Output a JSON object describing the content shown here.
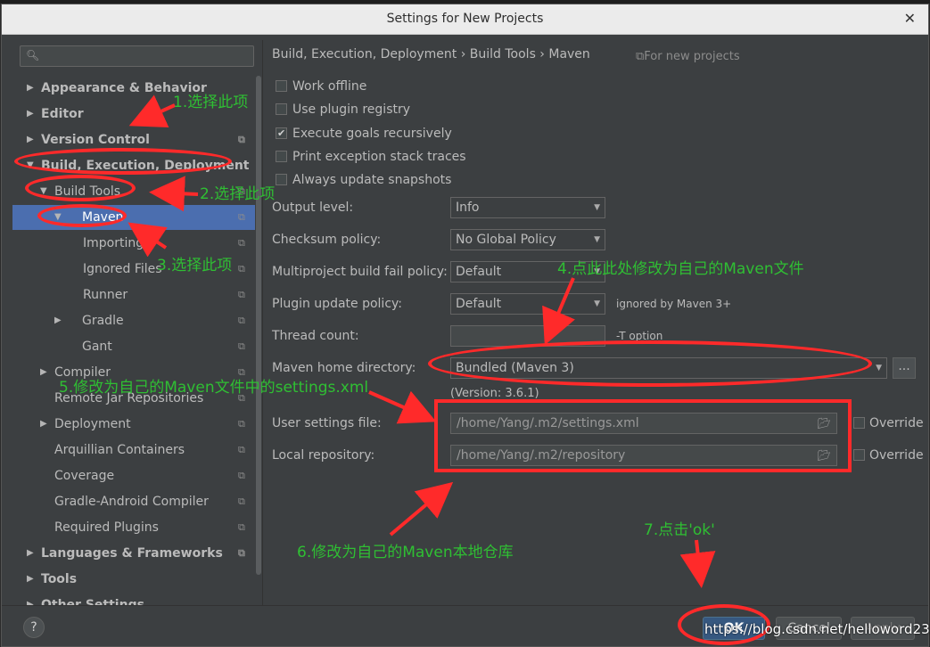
{
  "window": {
    "title": "Settings for New Projects"
  },
  "search": {
    "placeholder": ""
  },
  "tree": [
    {
      "label": "Appearance & Behavior",
      "bold": true,
      "depth": 0,
      "arrow": "right",
      "copy": false
    },
    {
      "label": "Editor",
      "bold": true,
      "depth": 0,
      "arrow": "right",
      "copy": false
    },
    {
      "label": "Version Control",
      "bold": true,
      "depth": 0,
      "arrow": "right",
      "copy": true
    },
    {
      "label": "Build, Execution, Deployment",
      "bold": true,
      "depth": 0,
      "arrow": "down",
      "copy": false
    },
    {
      "label": "Build Tools",
      "bold": false,
      "depth": 1,
      "arrow": "down",
      "copy": true
    },
    {
      "label": "Maven",
      "bold": false,
      "depth": 2,
      "arrow": "down",
      "copy": true,
      "selected": true
    },
    {
      "label": "Importing",
      "bold": false,
      "depth": 3,
      "arrow": "",
      "copy": true
    },
    {
      "label": "Ignored Files",
      "bold": false,
      "depth": 3,
      "arrow": "",
      "copy": true
    },
    {
      "label": "Runner",
      "bold": false,
      "depth": 3,
      "arrow": "",
      "copy": true
    },
    {
      "label": "Gradle",
      "bold": false,
      "depth": 2,
      "arrow": "right",
      "copy": true
    },
    {
      "label": "Gant",
      "bold": false,
      "depth": 2,
      "arrow": "",
      "copy": true
    },
    {
      "label": "Compiler",
      "bold": false,
      "depth": 1,
      "arrow": "right",
      "copy": true
    },
    {
      "label": "Remote Jar Repositories",
      "bold": false,
      "depth": 1,
      "arrow": "",
      "copy": true
    },
    {
      "label": "Deployment",
      "bold": false,
      "depth": 1,
      "arrow": "right",
      "copy": true
    },
    {
      "label": "Arquillian Containers",
      "bold": false,
      "depth": 1,
      "arrow": "",
      "copy": true
    },
    {
      "label": "Coverage",
      "bold": false,
      "depth": 1,
      "arrow": "",
      "copy": true
    },
    {
      "label": "Gradle-Android Compiler",
      "bold": false,
      "depth": 1,
      "arrow": "",
      "copy": true
    },
    {
      "label": "Required Plugins",
      "bold": false,
      "depth": 1,
      "arrow": "",
      "copy": true
    },
    {
      "label": "Languages & Frameworks",
      "bold": true,
      "depth": 0,
      "arrow": "right",
      "copy": true
    },
    {
      "label": "Tools",
      "bold": true,
      "depth": 0,
      "arrow": "right",
      "copy": false
    },
    {
      "label": "Other Settings",
      "bold": true,
      "depth": 0,
      "arrow": "right",
      "copy": false
    }
  ],
  "breadcrumb": {
    "text": "Build, Execution, Deployment  ›  Build Tools  ›  Maven"
  },
  "scope_note": "For new projects",
  "checkboxes": [
    {
      "label": "Work offline",
      "checked": false
    },
    {
      "label": "Use plugin registry",
      "checked": false
    },
    {
      "label": "Execute goals recursively",
      "checked": true
    },
    {
      "label": "Print exception stack traces",
      "checked": false
    },
    {
      "label": "Always update snapshots",
      "checked": false
    }
  ],
  "fields": {
    "output_level": {
      "label": "Output level:",
      "value": "Info"
    },
    "checksum_policy": {
      "label": "Checksum policy:",
      "value": "No Global Policy"
    },
    "fail_policy": {
      "label": "Multiproject build fail policy:",
      "value": "Default"
    },
    "plugin_update": {
      "label": "Plugin update policy:",
      "value": "Default",
      "hint": "ignored by Maven 3+"
    },
    "thread_count": {
      "label": "Thread count:",
      "value": "",
      "hint": "-T option"
    },
    "maven_home": {
      "label": "Maven home directory:",
      "value": "Bundled (Maven 3)",
      "version": "(Version: 3.6.1)",
      "browse": "..."
    },
    "user_settings": {
      "label": "User settings file:",
      "value": "/home/Yang/.m2/settings.xml",
      "override": "Override"
    },
    "local_repo": {
      "label": "Local repository:",
      "value": "/home/Yang/.m2/repository",
      "override": "Override"
    }
  },
  "buttons": {
    "help": "?",
    "ok": "OK",
    "cancel": "Cancel",
    "apply": "Apply"
  },
  "annotations": {
    "a1": "1.选择此项",
    "a2": "2.选择此项",
    "a3": "3.选择此项",
    "a4": "4.点此此处修改为自己的Maven文件",
    "a5": "5.修改为自己的Maven文件中的settings.xml",
    "a6": "6.修改为自己的Maven本地仓库",
    "a7": "7.点击'ok'"
  },
  "watermark": "https://blog.csdn.net/helloword233",
  "colors": {
    "annotation": "#2fbf33",
    "highlight": "#ff2a2a",
    "selection": "#4b6eaf"
  }
}
